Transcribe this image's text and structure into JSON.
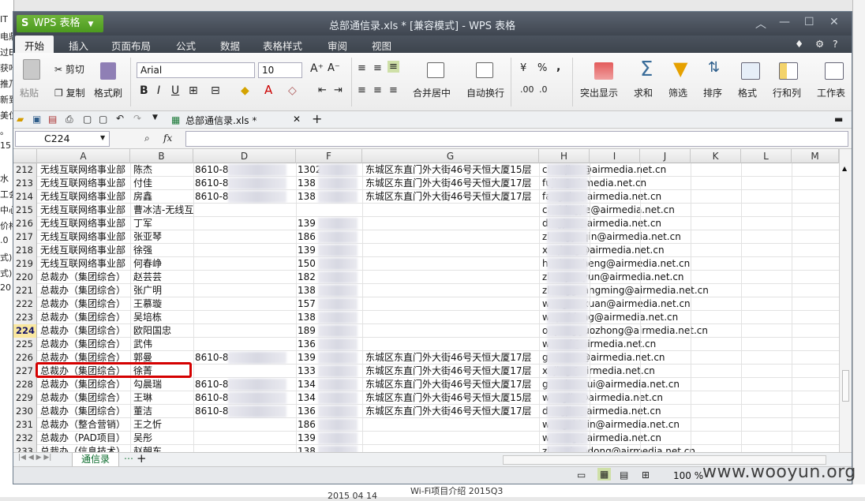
{
  "background": {
    "left_fragments": [
      "IT",
      "电鼎",
      "过E",
      "获叶",
      "推乃",
      "新到",
      "美位",
      "。",
      "15",
      "",
      "水",
      "工会",
      "中心",
      "价格",
      ".0",
      "式)",
      "式)",
      "20"
    ],
    "bottom_left": "2015 04 14",
    "bottom_right": "Wi-Fi项目介绍  2015Q3"
  },
  "app": {
    "logo_letter": "S",
    "app_name": "WPS 表格",
    "window_title": "总部通信录.xls * [兼容模式] - WPS 表格"
  },
  "menu": [
    "开始",
    "插入",
    "页面布局",
    "公式",
    "数据",
    "表格样式",
    "审阅",
    "视图"
  ],
  "ribbon": {
    "paste": "粘贴",
    "cut": "剪切",
    "copy": "复制",
    "format_painter": "格式刷",
    "font_name": "Arial",
    "font_size": "10",
    "merge_center": "合并居中",
    "wrap_text": "自动换行",
    "percent": "%",
    "comma": ",",
    "highlight": "突出显示",
    "sum": "求和",
    "filter": "筛选",
    "sort": "排序",
    "format": "格式",
    "rows_cols": "行和列",
    "worksheet": "工作表"
  },
  "document_tab": "总部通信录.xls *",
  "formula": {
    "cell_ref": "C224",
    "fx": "fx",
    "value": ""
  },
  "columns": [
    "A",
    "B",
    "D",
    "F",
    "G",
    "H",
    "I",
    "J",
    "K",
    "L",
    "M"
  ],
  "rows": [
    {
      "n": "212",
      "a": "无线互联网络事业部",
      "b": "陈杰",
      "d": "8610-8",
      "f": "1302",
      "g": "东城区东直门外大街46号天恒大厦15层",
      "h": "chenjie1@airmedia.net.cn"
    },
    {
      "n": "213",
      "a": "无线互联网络事业部",
      "b": "付佳",
      "d": "8610-8",
      "f": "138",
      "g": "东城区东直门外大街46号天恒大厦17层",
      "h": "fujia@airmedia.net.cn"
    },
    {
      "n": "214",
      "a": "无线互联网络事业部",
      "b": "房鑫",
      "d": "8610-8",
      "f": "138",
      "g": "东城区东直门外大街46号天恒大厦17层",
      "h": "fangxin@airmedia.net.cn"
    },
    {
      "n": "215",
      "a": "无线互联网络事业部",
      "b": "曹冰洁-无线互",
      "d": "",
      "f": "",
      "g": "",
      "h": "caobingjie@airmedia.net.cn"
    },
    {
      "n": "216",
      "a": "无线互联网络事业部",
      "b": "丁军",
      "d": "",
      "f": "139",
      "g": "",
      "h": "dingjun@airmedia.net.cn"
    },
    {
      "n": "217",
      "a": "无线互联网络事业部",
      "b": "张亚琴",
      "d": "",
      "f": "186",
      "g": "",
      "h": "zhangyaqin@airmedia.net.cn"
    },
    {
      "n": "218",
      "a": "无线互联网络事业部",
      "b": "徐强",
      "d": "",
      "f": "139",
      "g": "",
      "h": "xuqiang@airmedia.net.cn"
    },
    {
      "n": "219",
      "a": "无线互联网络事业部",
      "b": "何春峥",
      "d": "",
      "f": "150",
      "g": "",
      "h": "hechunzheng@airmedia.net.cn"
    },
    {
      "n": "220",
      "a": "总裁办（集团综合）",
      "b": "赵芸芸",
      "d": "",
      "f": "182",
      "g": "",
      "h": "zhaoyunyun@airmedia.net.cn"
    },
    {
      "n": "221",
      "a": "总裁办（集团综合）",
      "b": "张广明",
      "d": "",
      "f": "138",
      "g": "",
      "h": "zhangguangming@airmedia.net.cn"
    },
    {
      "n": "222",
      "a": "总裁办（集团综合）",
      "b": "王慕璇",
      "d": "",
      "f": "157",
      "g": "",
      "h": "wangmuxuan@airmedia.net.cn"
    },
    {
      "n": "223",
      "a": "总裁办（集团综合）",
      "b": "吴培栋",
      "d": "",
      "f": "138",
      "g": "",
      "h": "wupeidong@airmedia.net.cn"
    },
    {
      "n": "224",
      "a": "总裁办（集团综合）",
      "b": "欧阳国忠",
      "d": "",
      "f": "189",
      "g": "",
      "h": "ouyangguozhong@airmedia.net.cn"
    },
    {
      "n": "225",
      "a": "总裁办（集团综合）",
      "b": "武伟",
      "d": "",
      "f": "136",
      "g": "",
      "h": "wuwei@airmedia.net.cn"
    },
    {
      "n": "226",
      "a": "总裁办（集团综合）",
      "b": "郭曼",
      "d": "8610-8",
      "f": "139",
      "g": "东城区东直门外大街46号天恒大厦17层",
      "h": "guoman@airmedia.net.cn"
    },
    {
      "n": "227",
      "a": "总裁办（集团综合）",
      "b": "徐菁",
      "d": "",
      "f": "133",
      "g": "东城区东直门外大街46号天恒大厦17层",
      "h": "xujing@airmedia.net.cn"
    },
    {
      "n": "228",
      "a": "总裁办（集团综合）",
      "b": "勾晨瑞",
      "d": "8610-8",
      "f": "134",
      "g": "东城区东直门外大街46号天恒大厦17层",
      "h": "gouchenrui@airmedia.net.cn"
    },
    {
      "n": "229",
      "a": "总裁办（集团综合）",
      "b": "王琳",
      "d": "8610-8",
      "f": "134",
      "g": "东城区东直门外大街46号天恒大厦15层",
      "h": "wanglin@airmedia.net.cn"
    },
    {
      "n": "230",
      "a": "总裁办（集团综合）",
      "b": "董洁",
      "d": "8610-8",
      "f": "136",
      "g": "东城区东直门外大街46号天恒大厦17层",
      "h": "dongjie@airmedia.net.cn"
    },
    {
      "n": "231",
      "a": "总裁办（整合营销）",
      "b": "王之忻",
      "d": "",
      "f": "186",
      "g": "",
      "h": "wangzhixin@airmedia.net.cn"
    },
    {
      "n": "232",
      "a": "总裁办（PAD项目）",
      "b": "吴彤",
      "d": "",
      "f": "139",
      "g": "",
      "h": "wutong@airmedia.net.cn"
    },
    {
      "n": "233",
      "a": "总裁办（信息技术）",
      "b": "赵朝东",
      "d": "",
      "f": "138",
      "g": "",
      "h": "zhaochaodong@airmedia.net.cn"
    }
  ],
  "sheet_tab": "通信录",
  "status": {
    "zoom": "100 %"
  },
  "watermark": "www.wooyun.org"
}
